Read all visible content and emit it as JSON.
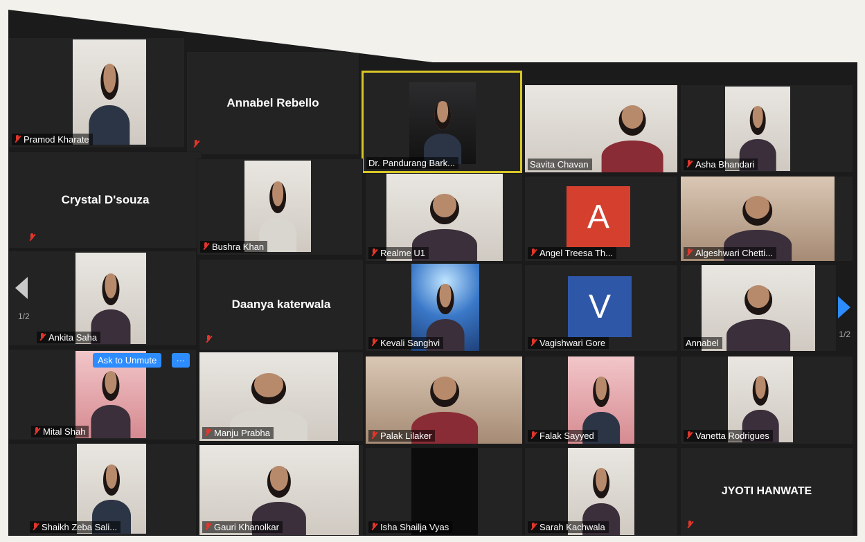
{
  "colors": {
    "active_border": "#d8c626",
    "muted_mic": "#e2362b",
    "accent": "#2d8cff"
  },
  "participants": {
    "pramod": "Pramod Kharate",
    "annabel_r": "Annabel Rebello",
    "pandurang": "Dr. Pandurang Bark...",
    "savita": "Savita Chavan",
    "asha": "Asha Bhandari",
    "crystal": "Crystal D'souza",
    "bushra": "Bushra Khan",
    "realme": "Realme U1",
    "angel": "Angel Treesa Th...",
    "algeshwari": "Algeshwari Chetti...",
    "ankita": "Ankita Saha",
    "daanya": "Daanya katerwala",
    "kevali": "Kevali Sanghvi",
    "vagishwari": "Vagishwari Gore",
    "annabel": "Annabel",
    "mital": "Mital Shah",
    "manju": "Manju Prabha",
    "palak": "Palak Lilaker",
    "falak": "Falak Sayyed",
    "vanetta": "Vanetta Rodrigues",
    "shaikh": "Shaikh Zeba Sali...",
    "gauri": "Gauri Khanolkar",
    "isha": "Isha Shailja Vyas",
    "sarah": "Sarah Kachwala",
    "jyoti": "JYOTI HANWATE"
  },
  "avatars": {
    "angel_letter": "A",
    "angel_color": "#d5402e",
    "vagishwari_letter": "V",
    "vagishwari_color": "#2f57a8"
  },
  "controls": {
    "ask_to_unmute": "Ask to Unmute",
    "more": "···"
  },
  "pagination": {
    "left": "1/2",
    "right": "1/2"
  }
}
